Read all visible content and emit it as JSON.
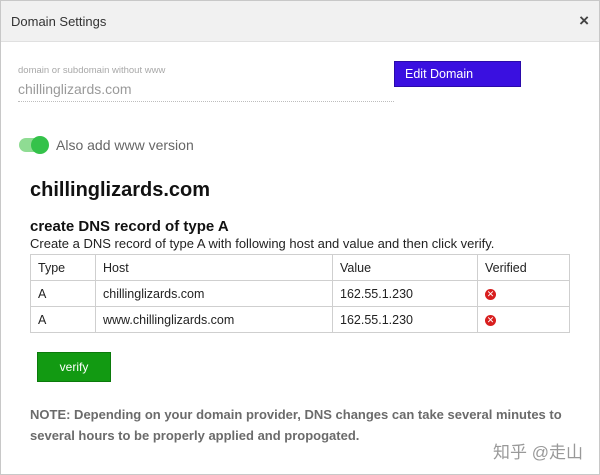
{
  "dialog": {
    "title": "Domain Settings",
    "close_glyph": "×"
  },
  "domain_input": {
    "label": "domain or subdomain without www",
    "value": "chillinglizards.com"
  },
  "edit_button": {
    "label": "Edit Domain"
  },
  "www_toggle": {
    "label": "Also add www version",
    "checked": true
  },
  "domain_heading": "chillinglizards.com",
  "dns": {
    "heading": "create DNS record of type A",
    "description": "Create a DNS record of type A with following host and value and then click verify.",
    "columns": [
      "Type",
      "Host",
      "Value",
      "Verified"
    ],
    "rows": [
      {
        "type": "A",
        "host": "chillinglizards.com",
        "value": "162.55.1.230",
        "verified_icon": "error-x-icon"
      },
      {
        "type": "A",
        "host": "www.chillinglizards.com",
        "value": "162.55.1.230",
        "verified_icon": "error-x-icon"
      }
    ]
  },
  "verify_button": {
    "label": "verify"
  },
  "note": "NOTE: Depending on your domain provider, DNS changes can take several minutes to several hours to be properly applied and propogated.",
  "watermark": "知乎 @走山",
  "colors": {
    "edit_button": "#3a10e0",
    "toggle_on": "#34c24a",
    "verify_button": "#129a12",
    "error_icon": "#d81e1e"
  }
}
